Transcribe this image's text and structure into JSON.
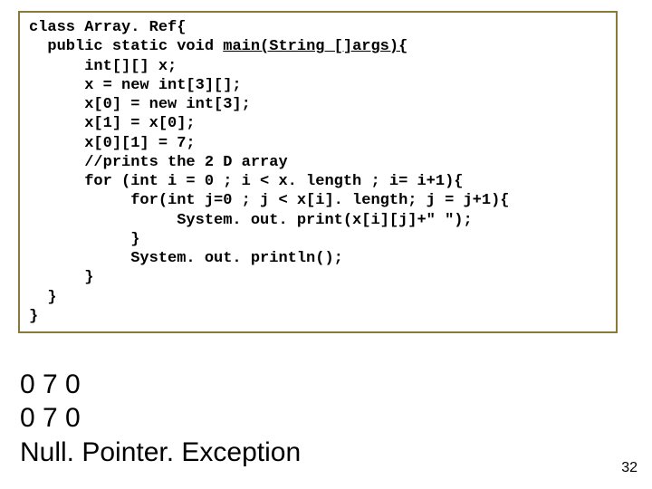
{
  "code": {
    "lines": [
      {
        "pre": "class Array. Ref{",
        "u": "",
        "post": ""
      },
      {
        "pre": "  public static void ",
        "u": "main(String []args){",
        "post": ""
      },
      {
        "pre": "      int[][] x;",
        "u": "",
        "post": ""
      },
      {
        "pre": "      x = new int[3][];",
        "u": "",
        "post": ""
      },
      {
        "pre": "      x[0] = new int[3];",
        "u": "",
        "post": ""
      },
      {
        "pre": "      x[1] = x[0];",
        "u": "",
        "post": ""
      },
      {
        "pre": "      x[0][1] = 7;",
        "u": "",
        "post": ""
      },
      {
        "pre": "      //prints the 2 D array",
        "u": "",
        "post": ""
      },
      {
        "pre": "      for (int i = 0 ; i < x. length ; i= i+1){",
        "u": "",
        "post": ""
      },
      {
        "pre": "           for(int j=0 ; j < x[i]. length; j = j+1){",
        "u": "",
        "post": ""
      },
      {
        "pre": "                System. out. print(x[i][j]+\" \");",
        "u": "",
        "post": ""
      },
      {
        "pre": "           }",
        "u": "",
        "post": ""
      },
      {
        "pre": "           System. out. println();",
        "u": "",
        "post": ""
      },
      {
        "pre": "      }",
        "u": "",
        "post": ""
      },
      {
        "pre": "  }",
        "u": "",
        "post": ""
      },
      {
        "pre": "}",
        "u": "",
        "post": ""
      }
    ]
  },
  "output": {
    "lines": [
      "0 7 0",
      "0 7 0",
      "Null. Pointer. Exception"
    ]
  },
  "page_number": "32"
}
